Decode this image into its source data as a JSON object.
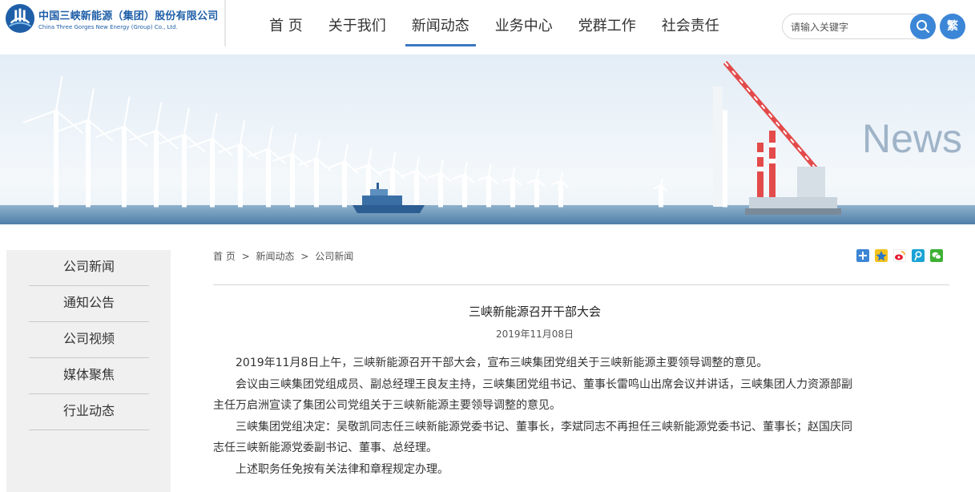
{
  "brand": {
    "name_cn": "中国三峡新能源（集团）股份有限公司",
    "name_en": "China Three Gorges New Energy (Group) Co., Ltd.",
    "color": "#1f5fa8"
  },
  "nav": {
    "items": [
      {
        "label": "首 页",
        "active": false
      },
      {
        "label": "关于我们",
        "active": false
      },
      {
        "label": "新闻动态",
        "active": true
      },
      {
        "label": "业务中心",
        "active": false
      },
      {
        "label": "党群工作",
        "active": false
      },
      {
        "label": "社会责任",
        "active": false
      }
    ],
    "accent": "#3b77c2"
  },
  "search": {
    "placeholder": "请输入关键字",
    "button_icon": "search-icon"
  },
  "lang_toggle": "繁",
  "banner": {
    "word": "News"
  },
  "sidebar": {
    "items": [
      {
        "label": "公司新闻"
      },
      {
        "label": "通知公告"
      },
      {
        "label": "公司视频"
      },
      {
        "label": "媒体聚焦"
      },
      {
        "label": "行业动态"
      }
    ]
  },
  "breadcrumb": {
    "home": "首 页",
    "sep": ">",
    "level1": "新闻动态",
    "level2": "公司新闻"
  },
  "share": {
    "icons": [
      "share-more-icon",
      "qzone-icon",
      "weibo-icon",
      "tencent-weibo-icon",
      "wechat-icon"
    ]
  },
  "article": {
    "title": "三峡新能源召开干部大会",
    "date": "2019年11月08日",
    "paragraphs": [
      "2019年11月8日上午，三峡新能源召开干部大会，宣布三峡集团党组关于三峡新能源主要领导调整的意见。",
      "会议由三峡集团党组成员、副总经理王良友主持，三峡集团党组书记、董事长雷鸣山出席会议并讲话，三峡集团人力资源部副主任万启洲宣读了集团公司党组关于三峡新能源主要领导调整的意见。",
      "三峡集团党组决定：吴敬凯同志任三峡新能源党委书记、董事长，李斌同志不再担任三峡新能源党委书记、董事长；赵国庆同志任三峡新能源党委副书记、董事、总经理。",
      "上述职务任免按有关法律和章程规定办理。"
    ]
  }
}
